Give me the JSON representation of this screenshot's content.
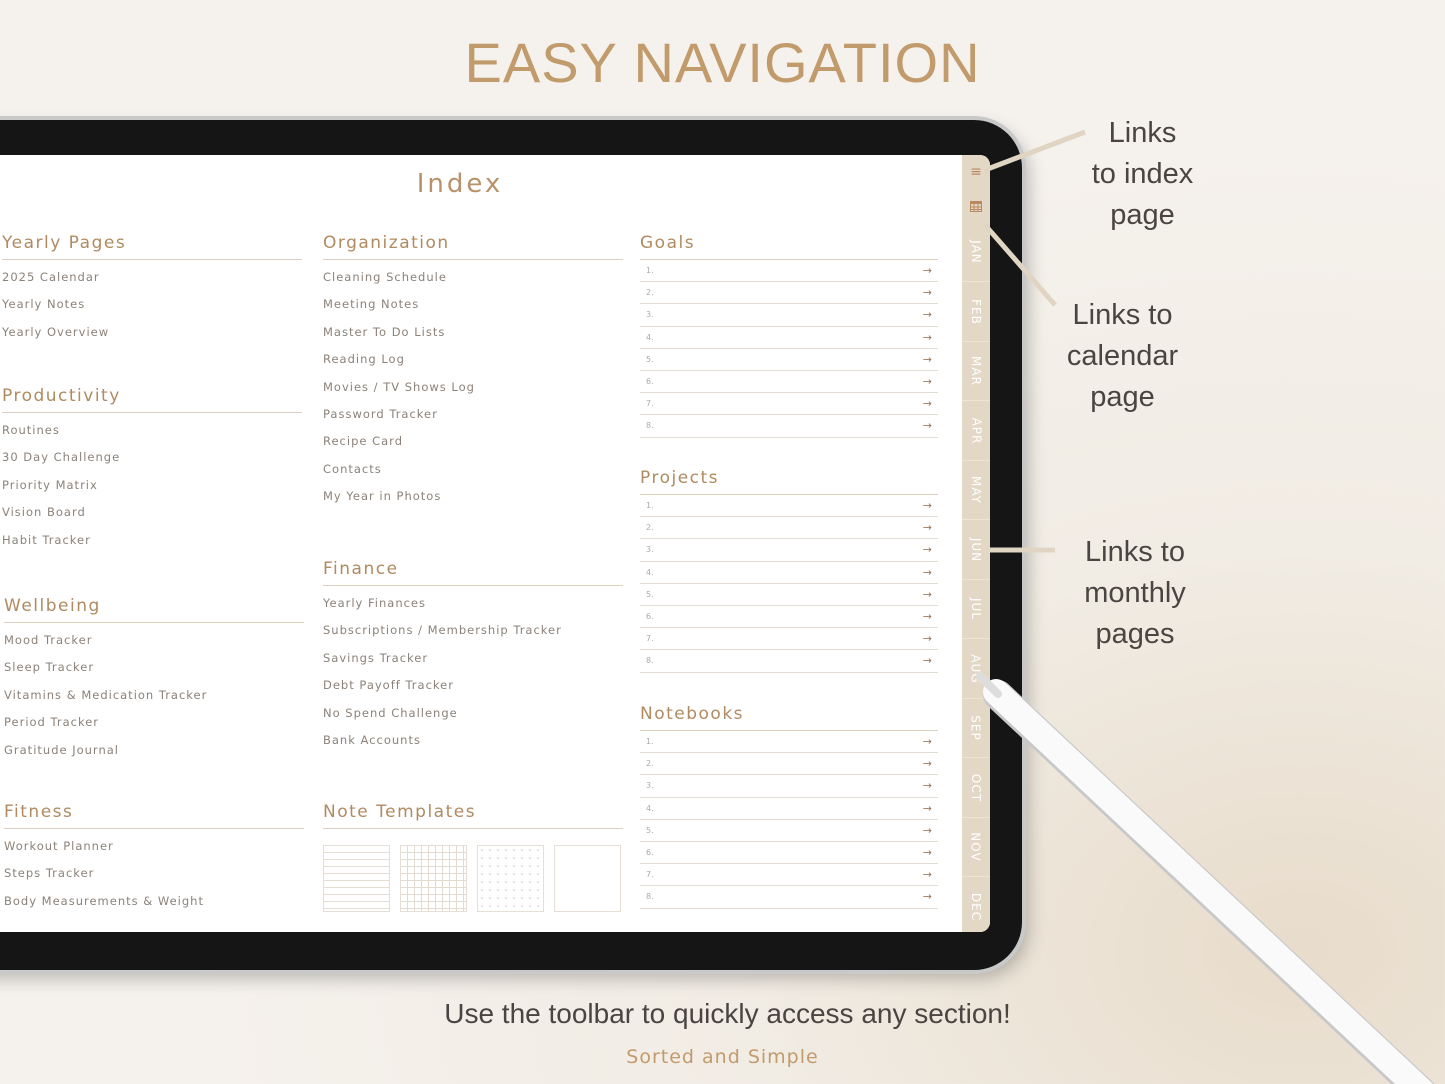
{
  "headline": "EASY NAVIGATION",
  "index": {
    "title": "Index",
    "sections": [
      {
        "key": "yearly",
        "title": "Yearly Pages",
        "items": [
          "2025 Calendar",
          "Yearly Notes",
          "Yearly Overview"
        ]
      },
      {
        "key": "productivity",
        "title": "Productivity",
        "items": [
          "Routines",
          "30 Day Challenge",
          "Priority Matrix",
          "Vision Board",
          "Habit Tracker"
        ]
      },
      {
        "key": "wellbeing",
        "title": "Wellbeing",
        "items": [
          "Mood Tracker",
          "Sleep Tracker",
          "Vitamins & Medication Tracker",
          "Period Tracker",
          "Gratitude Journal"
        ]
      },
      {
        "key": "fitness",
        "title": "Fitness",
        "items": [
          "Workout Planner",
          "Steps Tracker",
          "Body Measurements & Weight"
        ]
      },
      {
        "key": "organization",
        "title": "Organization",
        "items": [
          "Cleaning Schedule",
          "Meeting Notes",
          "Master To Do Lists",
          "Reading Log",
          "Movies / TV Shows Log",
          "Password Tracker",
          "Recipe Card",
          "Contacts",
          "My Year in Photos"
        ]
      },
      {
        "key": "finance",
        "title": "Finance",
        "items": [
          "Yearly Finances",
          "Subscriptions / Membership Tracker",
          "Savings Tracker",
          "Debt Payoff Tracker",
          "No Spend Challenge",
          "Bank Accounts"
        ]
      },
      {
        "key": "notes",
        "title": "Note Templates",
        "items": []
      }
    ],
    "lists": [
      {
        "title": "Goals",
        "rows": [
          "1.",
          "2.",
          "3.",
          "4.",
          "5.",
          "6.",
          "7.",
          "8."
        ]
      },
      {
        "title": "Projects",
        "rows": [
          "1.",
          "2.",
          "3.",
          "4.",
          "5.",
          "6.",
          "7.",
          "8."
        ]
      },
      {
        "title": "Notebooks",
        "rows": [
          "1.",
          "2.",
          "3.",
          "4.",
          "5.",
          "6.",
          "7.",
          "8."
        ]
      }
    ],
    "templates": [
      "lined",
      "grid",
      "dotted",
      "blank"
    ]
  },
  "toolbar": {
    "icons": [
      "menu-icon",
      "calendar-icon"
    ],
    "months": [
      "JAN",
      "FEB",
      "MAR",
      "APR",
      "MAY",
      "JUN",
      "JUL",
      "AUG",
      "SEP",
      "OCT",
      "NOV",
      "DEC"
    ]
  },
  "annotations": {
    "index": "Links\nto index\npage",
    "calendar": "Links to\ncalendar\npage",
    "monthly": "Links to\nmonthly\npages"
  },
  "footer": {
    "tagline": "Use the toolbar to quickly access any section!",
    "brand": "Sorted and Simple"
  },
  "colors": {
    "accent": "#c29b6c",
    "tab": "#e3d7c5",
    "bezel": "#151515"
  }
}
